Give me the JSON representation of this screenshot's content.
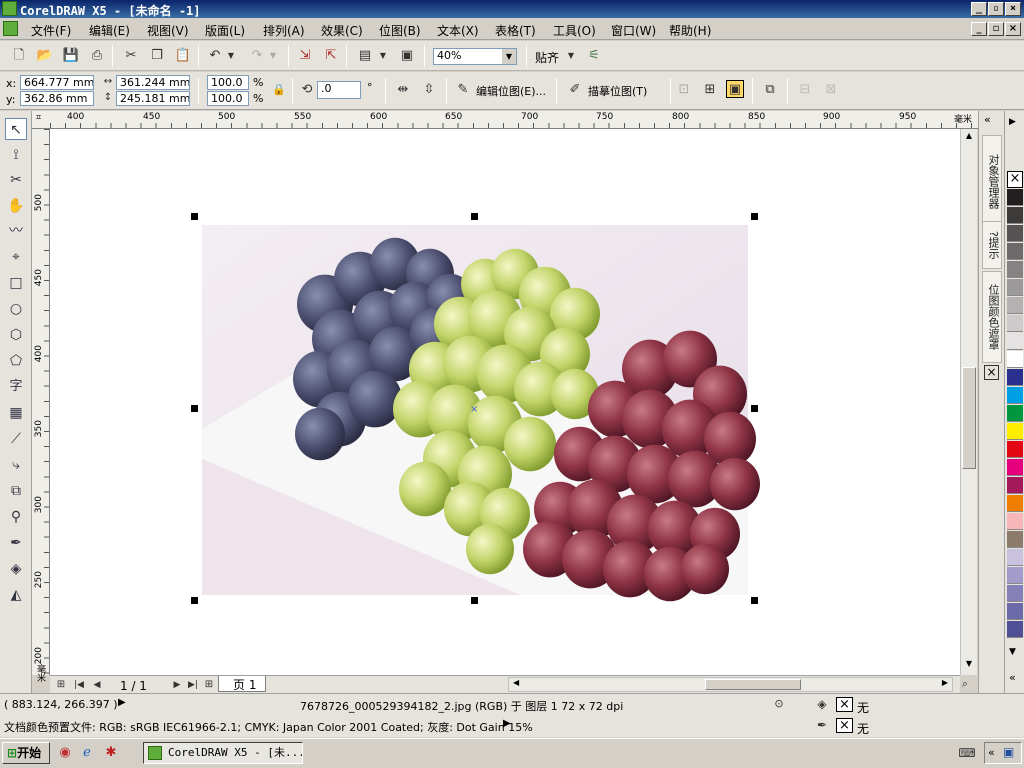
{
  "window": {
    "title": "CorelDRAW X5 - [未命名 -1]"
  },
  "menu": [
    "文件(F)",
    "编辑(E)",
    "视图(V)",
    "版面(L)",
    "排列(A)",
    "效果(C)",
    "位图(B)",
    "文本(X)",
    "表格(T)",
    "工具(O)",
    "窗口(W)",
    "帮助(H)"
  ],
  "toolbar": {
    "zoom_value": "40%",
    "snap_label": "贴齐"
  },
  "props": {
    "x_label": "x:",
    "y_label": "y:",
    "x_value": "664.777 mm",
    "y_value": "362.86 mm",
    "width_value": "361.244 mm",
    "height_value": "245.181 mm",
    "scale_x": "100.0",
    "scale_y": "100.0",
    "percent": "%",
    "rotation": ".0",
    "degree": "°",
    "edit_bitmap": "编辑位图(E)...",
    "trace_bitmap": "描摹位图(T)"
  },
  "ruler": {
    "h_ticks": [
      "400",
      "450",
      "500",
      "550",
      "600",
      "650",
      "700",
      "750",
      "800",
      "850",
      "900",
      "950"
    ],
    "h_unit": "毫米",
    "v_ticks": [
      "500",
      "450",
      "400",
      "350",
      "300",
      "250",
      "200"
    ],
    "v_unit": "毫米"
  },
  "dockers": {
    "object_manager": "对象管理器",
    "hints": "提示",
    "bitmap_color_mask": "位图颜色遮罩"
  },
  "palette_colors": [
    "#231f20",
    "#3d3a3a",
    "#555253",
    "#6d6a6b",
    "#858283",
    "#9c999a",
    "#b4b1b2",
    "#cccacb",
    "#e4e2e3",
    "#ffffff",
    "#2b2f8e",
    "#009fe3",
    "#009640",
    "#ffed00",
    "#e30613",
    "#e6007e",
    "#a3195b",
    "#ef7d00",
    "#f7b6b8",
    "#8c7a6b",
    "#c9c2df",
    "#a39bc9",
    "#8580b8",
    "#6c6aa8",
    "#4e4f95"
  ],
  "page_nav": {
    "page_count": "1 / 1",
    "page_tab": "页 1"
  },
  "status": {
    "coords": "( 883.124, 266.397 )",
    "file_info": "7678726_000529394182_2.jpg (RGB) 于 图层 1 72 x 72 dpi",
    "color_profile": "文档颜色预置文件: RGB: sRGB IEC61966-2.1; CMYK: Japan Color 2001 Coated; 灰度: Dot Gain 15%",
    "fill_none": "无",
    "outline_none": "无"
  },
  "taskbar": {
    "start": "开始",
    "task": "CorelDRAW X5 - [未..."
  }
}
